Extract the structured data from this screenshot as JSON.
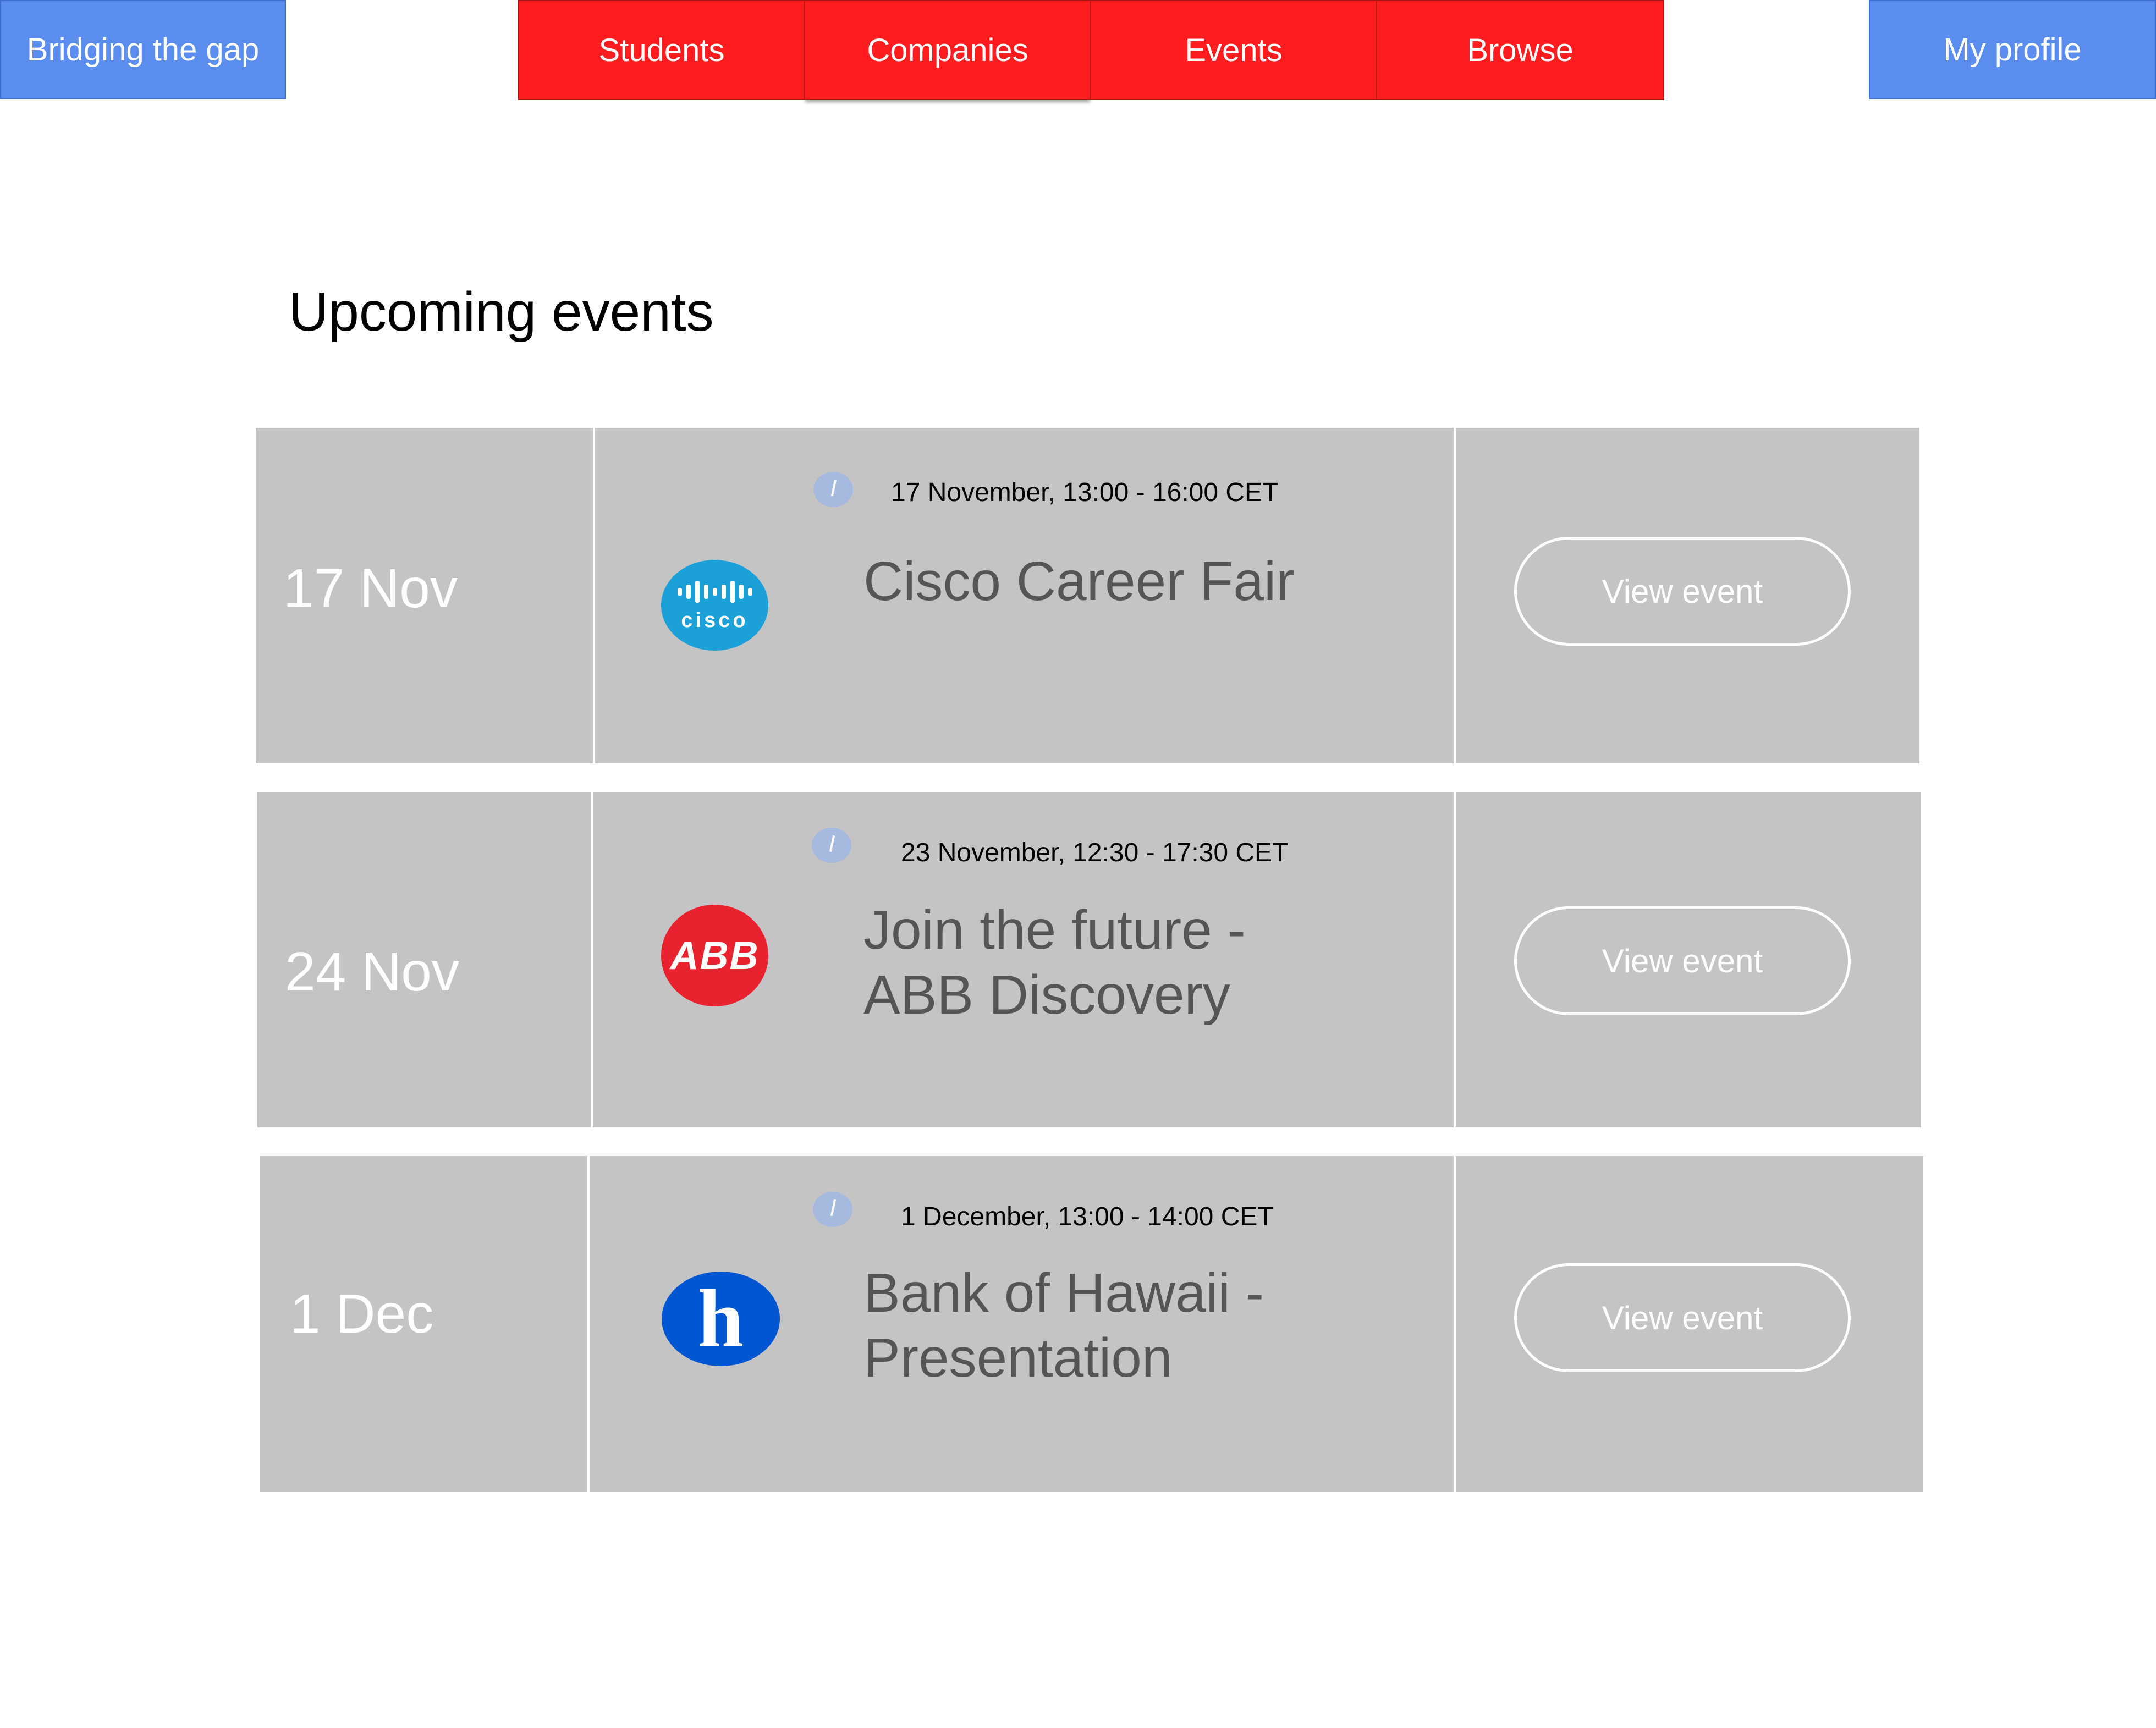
{
  "header": {
    "brand_label": "Bridging the gap",
    "profile_label": "My profile",
    "nav": [
      {
        "label": "Students"
      },
      {
        "label": "Companies"
      },
      {
        "label": "Events"
      },
      {
        "label": "Browse"
      }
    ]
  },
  "main": {
    "title": "Upcoming events",
    "events": [
      {
        "date": "17 Nov",
        "time": "17 November, 13:00 - 16:00 CET",
        "title": "Cisco Career Fair",
        "button": "View event",
        "logo": {
          "icon": "cisco-logo",
          "text": "cisco"
        }
      },
      {
        "date": "24 Nov",
        "time": "23 November, 12:30 - 17:30 CET",
        "title_line1": "Join the future -",
        "title_line2": "ABB Discovery",
        "button": "View event",
        "logo": {
          "icon": "abb-logo",
          "text": "ABB"
        }
      },
      {
        "date": "1 Dec",
        "time": "1 December, 13:00 - 14:00 CET",
        "title_line1": "Bank of Hawaii -",
        "title_line2": "Presentation",
        "button": "View event",
        "logo": {
          "icon": "bank-of-hawaii-logo",
          "text": "h"
        }
      }
    ]
  },
  "colors": {
    "brand_blue": "#5b8def",
    "nav_red": "#ff1c1f",
    "card_gray": "#c4c4c4",
    "title_gray": "#555555"
  }
}
